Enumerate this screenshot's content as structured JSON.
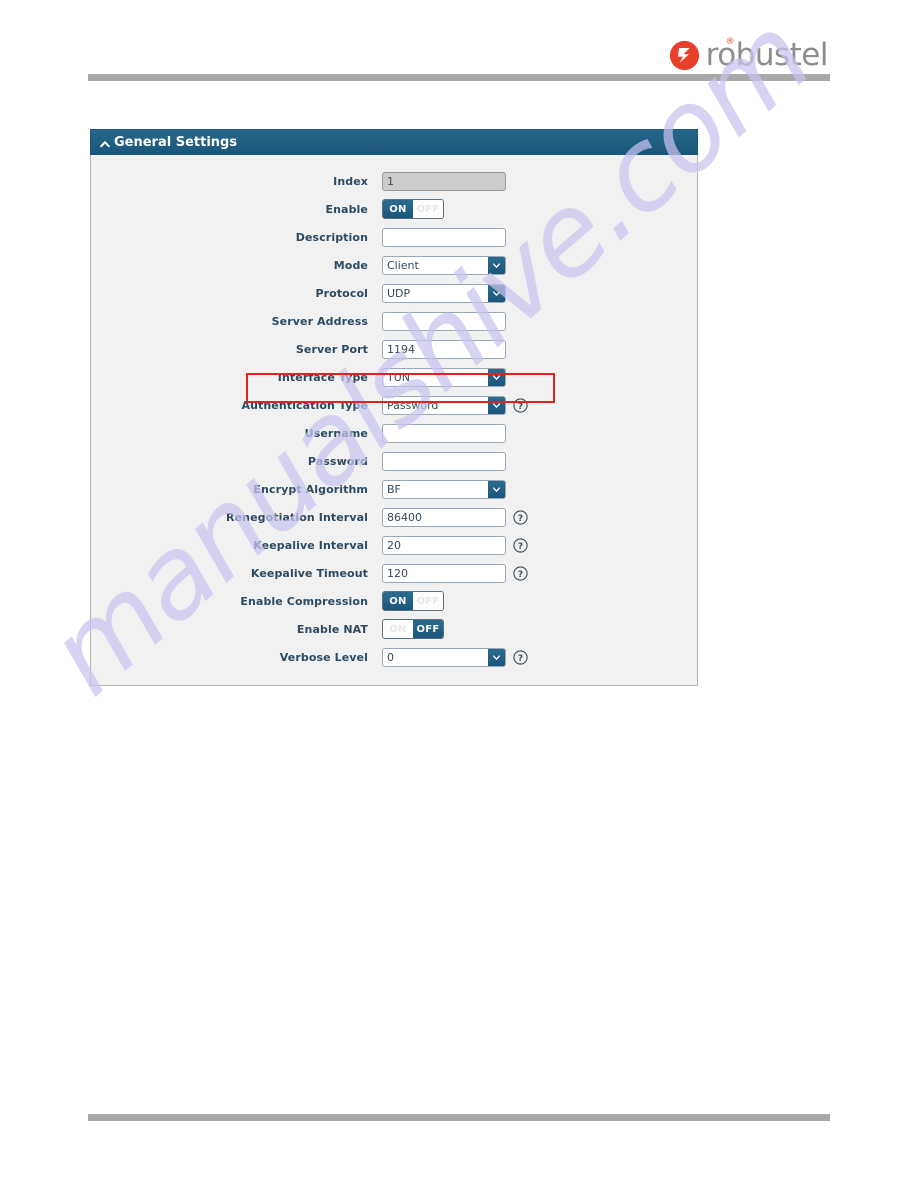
{
  "brand": {
    "name": "robustel",
    "mark_icon": "robustel-logo-mark",
    "registered_mark": "®"
  },
  "panel": {
    "title": "General Settings",
    "collapse_icon": "caret-up-icon",
    "rows": [
      {
        "label": "Index",
        "type": "text",
        "value": "1",
        "disabled": true,
        "help": false
      },
      {
        "label": "Enable",
        "type": "toggle",
        "value": "ON",
        "on_label": "ON",
        "off_label": "OFF",
        "state": "on",
        "help": false
      },
      {
        "label": "Description",
        "type": "text",
        "value": "",
        "disabled": false,
        "help": false
      },
      {
        "label": "Mode",
        "type": "select",
        "value": "Client",
        "help": false
      },
      {
        "label": "Protocol",
        "type": "select",
        "value": "UDP",
        "help": false
      },
      {
        "label": "Server Address",
        "type": "text",
        "value": "",
        "disabled": false,
        "help": false
      },
      {
        "label": "Server Port",
        "type": "text",
        "value": "1194",
        "disabled": false,
        "help": false
      },
      {
        "label": "Interface Type",
        "type": "select",
        "value": "TUN",
        "help": false
      },
      {
        "label": "Authentication Type",
        "type": "select",
        "value": "Password",
        "help": true,
        "highlighted": true
      },
      {
        "label": "Username",
        "type": "text",
        "value": "",
        "disabled": false,
        "help": false
      },
      {
        "label": "Password",
        "type": "text",
        "value": "",
        "disabled": false,
        "help": false
      },
      {
        "label": "Encrypt Algorithm",
        "type": "select",
        "value": "BF",
        "help": false
      },
      {
        "label": "Renegotiation Interval",
        "type": "text",
        "value": "86400",
        "disabled": false,
        "help": true
      },
      {
        "label": "Keepalive Interval",
        "type": "text",
        "value": "20",
        "disabled": false,
        "help": true
      },
      {
        "label": "Keepalive Timeout",
        "type": "text",
        "value": "120",
        "disabled": false,
        "help": true
      },
      {
        "label": "Enable Compression",
        "type": "toggle",
        "value": "ON",
        "on_label": "ON",
        "off_label": "OFF",
        "state": "on",
        "help": false
      },
      {
        "label": "Enable NAT",
        "type": "toggle",
        "value": "OFF",
        "on_label": "ON",
        "off_label": "OFF",
        "state": "off",
        "help": false
      },
      {
        "label": "Verbose Level",
        "type": "select",
        "value": "0",
        "help": true
      }
    ]
  },
  "watermark": {
    "text": "manualshive.com"
  },
  "colors": {
    "panel_header": "#1f5f85",
    "accent_blue": "#1b5679",
    "label_text": "#2d4a63",
    "highlight_red": "#e81f1f",
    "brand_red": "#e8402a",
    "rule_gray": "#a8a8a8",
    "watermark": "#c9c4ef"
  }
}
